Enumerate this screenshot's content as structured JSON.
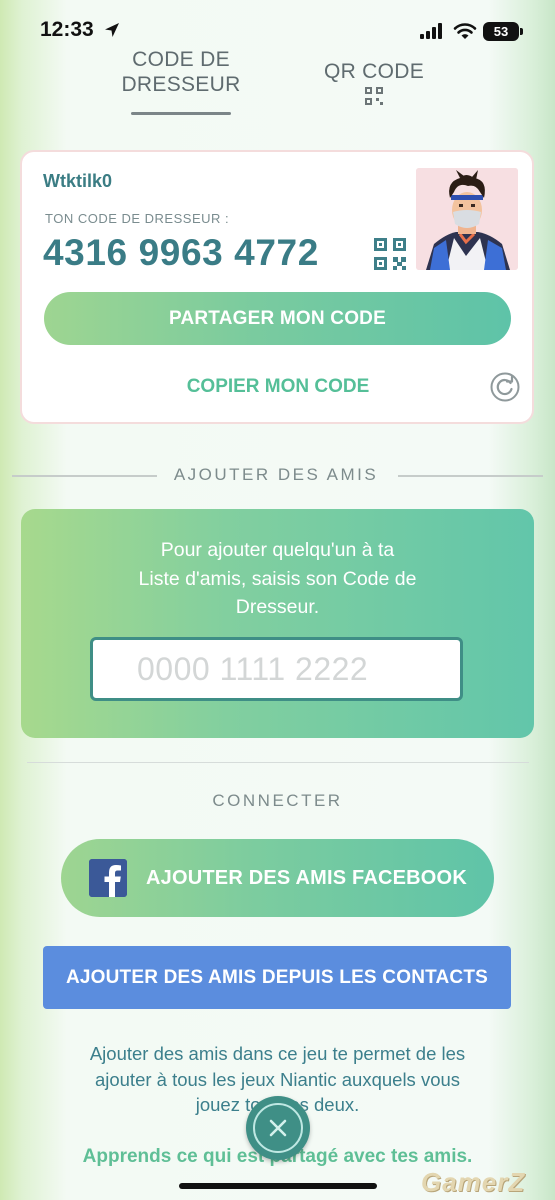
{
  "status_bar": {
    "time": "12:33",
    "battery": "53"
  },
  "tabs": [
    {
      "label_line1": "CODE DE",
      "label_line2": "DRESSEUR",
      "active": true
    },
    {
      "label": "QR CODE",
      "active": false
    }
  ],
  "trainer_card": {
    "username": "Wtktilk0",
    "code_label": "TON CODE DE DRESSEUR :",
    "code": "4316 9963 4772",
    "share_label": "PARTAGER MON CODE",
    "copy_label": "COPIER MON CODE"
  },
  "add_friends": {
    "section_title": "AJOUTER DES AMIS",
    "instruction_line1": "Pour ajouter quelqu'un à ta",
    "instruction_line2": "Liste d'amis, saisis son Code de",
    "instruction_line3": "Dresseur.",
    "input_placeholder": "0000 1111 2222",
    "input_value": ""
  },
  "connect": {
    "section_title": "CONNECTER",
    "facebook_label": "AJOUTER DES AMIS FACEBOOK",
    "contacts_label": "AJOUTER DES AMIS DEPUIS LES CONTACTS",
    "info_line1": "Ajouter des amis dans ce jeu te permet de les",
    "info_line2": "ajouter à tous les jeux Niantic auxquels vous",
    "info_line3": "jouez tous les deux.",
    "learn_more": "Apprends ce qui est partagé avec tes amis."
  },
  "watermark": "GamerZ",
  "colors": {
    "accent_green": "#5fc4a8",
    "teal_text": "#3a7c86",
    "contacts_blue": "#5b8dde",
    "facebook_blue": "#3b5998"
  },
  "icons": [
    "location-arrow-icon",
    "cellular-signal-icon",
    "wifi-icon",
    "battery-icon",
    "qr-code-icon",
    "refresh-icon",
    "facebook-icon",
    "close-icon"
  ]
}
